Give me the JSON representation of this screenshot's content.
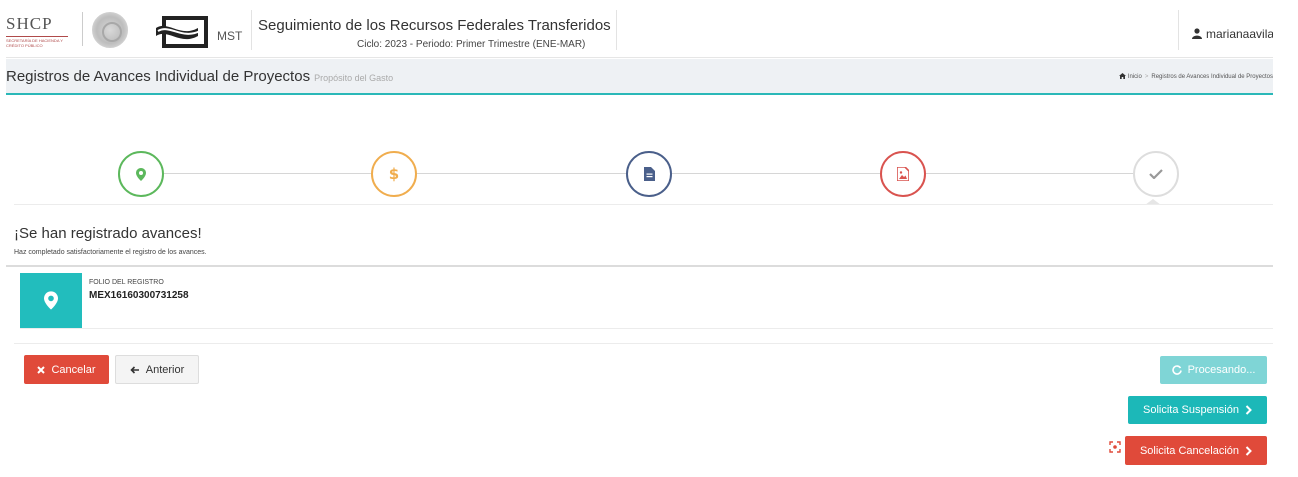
{
  "header": {
    "logo_text": "SHCP",
    "logo_subtext": "SECRETARÍA DE HACIENDA Y CRÉDITO PÚBLICO",
    "app_abbrev": "MST",
    "system_title": "Seguimiento de los Recursos Federales Transferidos",
    "system_subtitle": "Ciclo: 2023 - Periodo: Primer Trimestre (ENE-MAR)",
    "user_name": "marianaavila"
  },
  "page": {
    "title": "Registros de Avances Individual de Proyectos",
    "subtitle": "Propósito del Gasto",
    "breadcrumb": [
      "Inicio",
      "Registros de Avances Individual de Proyectos"
    ]
  },
  "wizard": {
    "steps": [
      {
        "icon": "map-marker-icon",
        "color": "#5cb85c"
      },
      {
        "icon": "dollar-icon",
        "color": "#f0ad4e"
      },
      {
        "icon": "document-icon",
        "color": "#4a5f8a"
      },
      {
        "icon": "image-icon",
        "color": "#d9534f"
      },
      {
        "icon": "check-icon",
        "color": "#bbbbbb"
      }
    ],
    "active_step": 5
  },
  "success": {
    "title": "¡Se han registrado avances!",
    "message": "Haz completado satisfactoriamente el registro de los avances.",
    "folio_label": "FOLIO DEL REGISTRO",
    "folio_value": "MEX16160300731258"
  },
  "buttons": {
    "cancel": "Cancelar",
    "previous": "Anterior",
    "processing": "Procesando...",
    "request_suspension": "Solicita Suspensión",
    "request_cancellation": "Solicita Cancelación"
  },
  "colors": {
    "accent": "#2ab8b8",
    "danger": "#e04a3a",
    "teal": "#1cb8b8"
  }
}
